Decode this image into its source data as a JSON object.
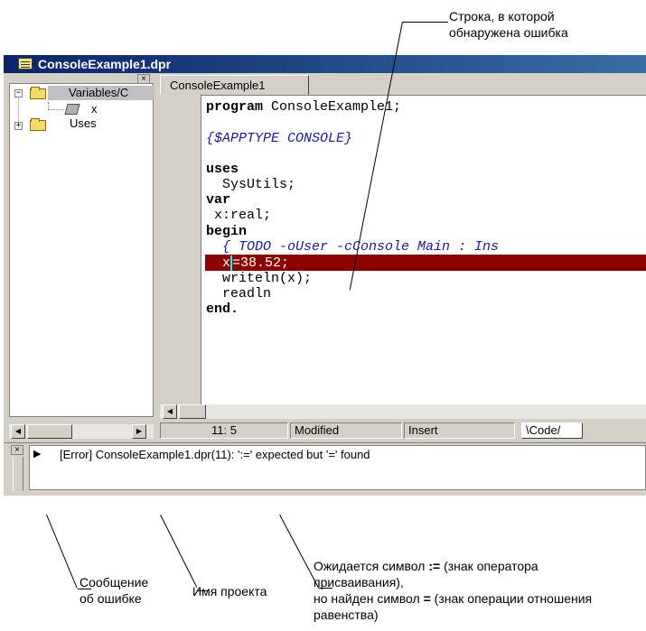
{
  "annotations": {
    "error_line_label_1": "Строка, в которой",
    "error_line_label_2": "обнаружена ошибка",
    "message_label_1": "Сообщение",
    "message_label_2": "об ошибке",
    "project_label": "Имя проекта",
    "explain_1_prefix": "Ожидается символ ",
    "explain_1_symbol": ":=",
    "explain_1_suffix": " (знак оператора",
    "explain_2": "присваивания),",
    "explain_3_prefix": "но найден символ ",
    "explain_3_symbol": "=",
    "explain_3_suffix": " (знак операции отношения",
    "explain_4": "равенства)"
  },
  "window": {
    "title": "ConsoleExample1.dpr"
  },
  "tree": {
    "close_glyph": "×",
    "items": [
      {
        "expander": "−",
        "label": "Variables/C"
      },
      {
        "label": "x"
      },
      {
        "expander": "+",
        "label": "Uses"
      }
    ]
  },
  "editor": {
    "tab_label": "ConsoleExample1",
    "lines": {
      "l1_kw": "program",
      "l1_rest": " ConsoleExample1;",
      "l2": "{$APPTYPE CONSOLE}",
      "l3": "uses",
      "l4": "  SysUtils;",
      "l5": "var",
      "l6": " x:real;",
      "l7": "begin",
      "l8": "  { TODO -oUser -cConsole Main : Ins",
      "l9_a": "  x",
      "l9_cursor": "=",
      "l9_b": "38.52;",
      "l10": "  writeln(x);",
      "l11": "  readln",
      "l12": "end."
    }
  },
  "status_bar": {
    "position": "11:  5",
    "modified": "Modified",
    "mode": "Insert",
    "view_tab": "\\Code/"
  },
  "messages": {
    "close_glyph": "×",
    "arrow": "▶",
    "error_text": "[Error] ConsoleExample1.dpr(11): ':=' expected but '=' found"
  },
  "colors": {
    "error_line": "#8b0000",
    "title_bar": "#0a246a",
    "comment": "#1a1aa0"
  }
}
